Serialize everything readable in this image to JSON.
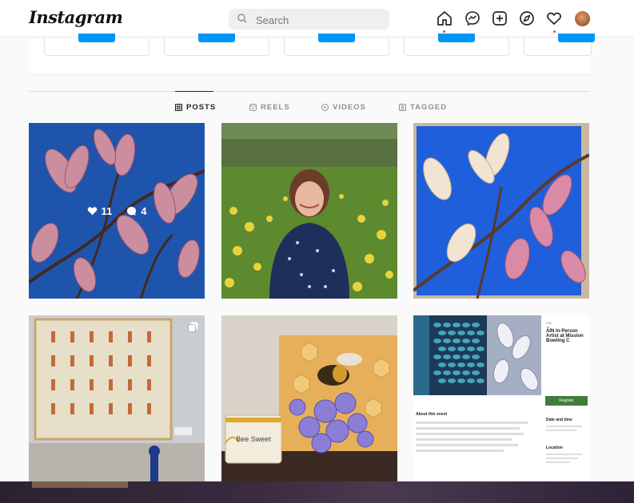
{
  "app": {
    "logo_text": "Instagram"
  },
  "search": {
    "placeholder": "Search"
  },
  "nav": {
    "icons": [
      "home-icon",
      "messenger-icon",
      "new-post-icon",
      "explore-icon",
      "activity-heart-icon",
      "profile-avatar"
    ]
  },
  "tabs": [
    {
      "label": "POSTS",
      "icon": "grid-icon",
      "active": true
    },
    {
      "label": "REELS",
      "icon": "reels-icon",
      "active": false
    },
    {
      "label": "VIDEOS",
      "icon": "play-icon",
      "active": false
    },
    {
      "label": "TAGGED",
      "icon": "tagged-icon",
      "active": false
    }
  ],
  "posts": [
    {
      "subject": "Pink magnolia branches against a blue sky",
      "likes": "11",
      "comments": "4",
      "hovered": true
    },
    {
      "subject": "Smiling woman sitting among yellow daffodils"
    },
    {
      "subject": "Painting of magnolia blossoms on blue canvas"
    },
    {
      "subject": "Painting with rows of small red figures",
      "multi": true
    },
    {
      "subject": "Bee on purple flowers painting with mug",
      "mug_text": "Bee Sweet"
    },
    {
      "subject": "Event flyer",
      "event": {
        "date_month": "Feb",
        "date_day": "16",
        "title": "AIN In-Person Artist at Mission Bowling C",
        "register_label": "Register",
        "date_heading": "Date and time",
        "location_heading": "Location",
        "about_heading": "About this event"
      }
    }
  ],
  "colors": {
    "accent": "#0095f6",
    "notification": "#ed4956",
    "event_register": "#3f7d3a"
  }
}
